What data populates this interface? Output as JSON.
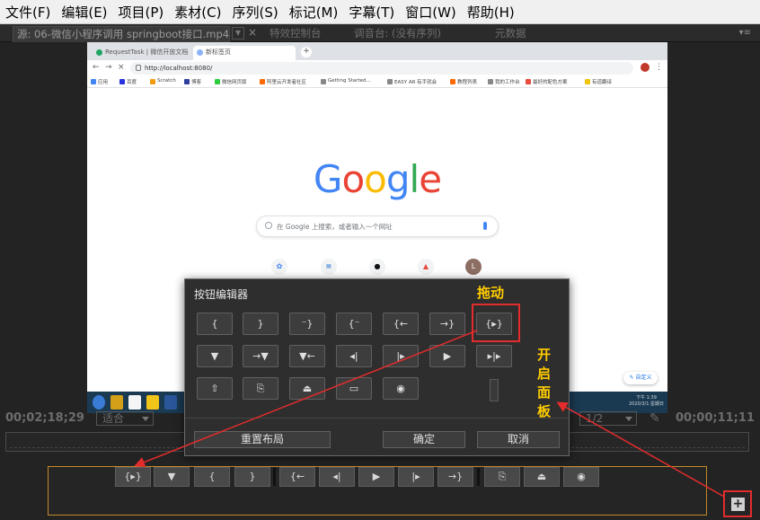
{
  "menubar": {
    "items": [
      "文件(F)",
      "编辑(E)",
      "项目(P)",
      "素材(C)",
      "序列(S)",
      "标记(M)",
      "字幕(T)",
      "窗口(W)",
      "帮助(H)"
    ]
  },
  "tabs": {
    "source": "源: 06-微信小程序调用 springboot接口.mp4",
    "effects": "特效控制台",
    "mixer": "调音台: (没有序列)",
    "metadata": "元数据"
  },
  "browser": {
    "tab1": "RequestTask | 微信开放文档",
    "tab2": "新标签页",
    "url": "http://localhost:8080/",
    "bookmarks": [
      "应用",
      "百度",
      "Scratch",
      "博客",
      "微信网页版",
      "阿里云开发者社区",
      "Getting Started...",
      "EASY AR 有手就会",
      "教程列表",
      "我的工作台",
      "最好的配色方案",
      "有道翻译"
    ],
    "google_letters": [
      "G",
      "o",
      "o",
      "g",
      "l",
      "e"
    ],
    "search_placeholder": "在 Google 上搜索，或者输入一个网址",
    "customize_label": "自定义",
    "tray_time": "下午 1:39",
    "tray_date": "2020/3/1 星期日"
  },
  "timecode": {
    "left": "00;02;18;29",
    "fit_label": "适合",
    "resolution": "1/2",
    "right": "00;00;11;11"
  },
  "dialog": {
    "title": "按钮编辑器",
    "reset_label": "重置布局",
    "ok_label": "确定",
    "cancel_label": "取消",
    "row1": [
      "{",
      "}",
      "⁻}",
      "{⁻",
      "{←",
      "→}",
      "{▸}"
    ],
    "row2": [
      "▼",
      "→▼",
      "▼←",
      "◂|",
      "|▸",
      "▶",
      "▸|▸"
    ],
    "row3": [
      "⇧",
      "⎘",
      "⏏",
      "▭",
      "◉"
    ]
  },
  "annotations": {
    "drag_label": "拖动",
    "open_panel_label": "开启面板",
    "open_panel_chars": [
      "开",
      "启",
      "面",
      "板"
    ]
  },
  "bottom_toolbar": {
    "group1": [
      "{▸}",
      "▼",
      "{",
      "}"
    ],
    "group2": [
      "{←",
      "◂|",
      "▶",
      "|▸",
      "→}"
    ],
    "group3": [
      "⎘",
      "⏏",
      "◉"
    ]
  },
  "colors": {
    "annotation_red": "#e32c2c",
    "annotation_yellow": "#ffcc00",
    "toolbar_outline": "#c28a2a"
  }
}
